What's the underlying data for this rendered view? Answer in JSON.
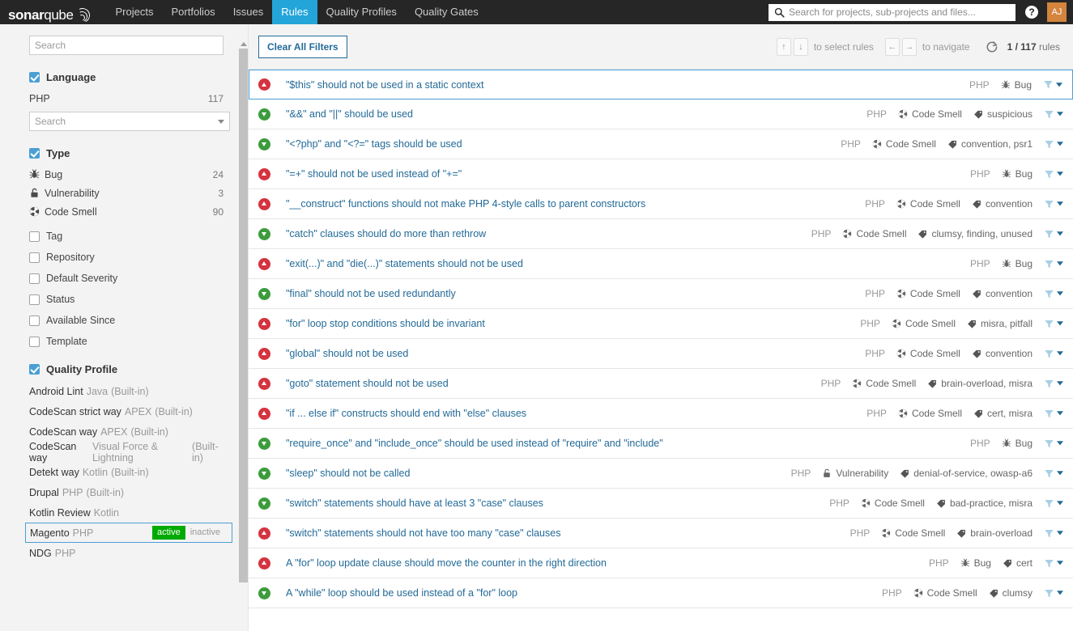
{
  "topnav": {
    "logo_main": "sonar",
    "logo_lite": "qube",
    "items": [
      {
        "label": "Projects",
        "active": false
      },
      {
        "label": "Portfolios",
        "active": false
      },
      {
        "label": "Issues",
        "active": false
      },
      {
        "label": "Rules",
        "active": true
      },
      {
        "label": "Quality Profiles",
        "active": false
      },
      {
        "label": "Quality Gates",
        "active": false
      }
    ],
    "search_placeholder": "Search for projects, sub-projects and files...",
    "help_label": "?",
    "avatar_initials": "AJ"
  },
  "sidebar": {
    "search_placeholder": "Search",
    "language_facet": {
      "title": "Language",
      "checked": true,
      "items": [
        {
          "label": "PHP",
          "count": "117"
        }
      ],
      "select_placeholder": "Search"
    },
    "type_facet": {
      "title": "Type",
      "checked": true,
      "items": [
        {
          "label": "Bug",
          "count": "24",
          "icon": "bug-icon"
        },
        {
          "label": "Vulnerability",
          "count": "3",
          "icon": "vulnerability-icon"
        },
        {
          "label": "Code Smell",
          "count": "90",
          "icon": "code-smell-icon"
        }
      ]
    },
    "collapsed_facets": [
      {
        "label": "Tag"
      },
      {
        "label": "Repository"
      },
      {
        "label": "Default Severity"
      },
      {
        "label": "Status"
      },
      {
        "label": "Available Since"
      },
      {
        "label": "Template"
      }
    ],
    "quality_profile_facet": {
      "title": "Quality Profile",
      "checked": true,
      "active_label": "active",
      "inactive_label": "inactive",
      "items": [
        {
          "name": "Android Lint",
          "lang": "Java",
          "builtin": "(Built-in)",
          "selected": false
        },
        {
          "name": "CodeScan strict way",
          "lang": "APEX",
          "builtin": "(Built-in)",
          "selected": false
        },
        {
          "name": "CodeScan way",
          "lang": "APEX",
          "builtin": "(Built-in)",
          "selected": false
        },
        {
          "name": "CodeScan way",
          "lang": "Visual Force & Lightning",
          "builtin": "(Built-in)",
          "selected": false
        },
        {
          "name": "Detekt way",
          "lang": "Kotlin",
          "builtin": "(Built-in)",
          "selected": false
        },
        {
          "name": "Drupal",
          "lang": "PHP",
          "builtin": "(Built-in)",
          "selected": false
        },
        {
          "name": "Kotlin Review",
          "lang": "Kotlin",
          "builtin": "",
          "selected": false
        },
        {
          "name": "Magento",
          "lang": "PHP",
          "builtin": "",
          "selected": true
        },
        {
          "name": "NDG",
          "lang": "PHP",
          "builtin": "",
          "selected": false
        }
      ]
    }
  },
  "toolbar": {
    "clear_filters_label": "Clear All Filters",
    "key_up": "↑",
    "key_down": "↓",
    "select_hint": "to select rules",
    "key_left": "←",
    "key_right": "→",
    "navigate_hint": "to navigate",
    "rule_position": "1 / 117",
    "rules_word": "rules"
  },
  "rules": [
    {
      "severity": "red",
      "name": "\"$this\" should not be used in a static context",
      "lang": "PHP",
      "type": "Bug",
      "type_icon": "bug-icon",
      "tags": "",
      "selected": true
    },
    {
      "severity": "green",
      "name": "\"&&\" and \"||\" should be used",
      "lang": "PHP",
      "type": "Code Smell",
      "type_icon": "code-smell-icon",
      "tags": "suspicious",
      "selected": false
    },
    {
      "severity": "green",
      "name": "\"<?php\" and \"<?=\" tags should be used",
      "lang": "PHP",
      "type": "Code Smell",
      "type_icon": "code-smell-icon",
      "tags": "convention, psr1",
      "selected": false
    },
    {
      "severity": "red",
      "name": "\"=+\" should not be used instead of \"+=\"",
      "lang": "PHP",
      "type": "Bug",
      "type_icon": "bug-icon",
      "tags": "",
      "selected": false
    },
    {
      "severity": "red",
      "name": "\"__construct\" functions should not make PHP 4-style calls to parent constructors",
      "lang": "PHP",
      "type": "Code Smell",
      "type_icon": "code-smell-icon",
      "tags": "convention",
      "selected": false
    },
    {
      "severity": "green",
      "name": "\"catch\" clauses should do more than rethrow",
      "lang": "PHP",
      "type": "Code Smell",
      "type_icon": "code-smell-icon",
      "tags": "clumsy, finding, unused",
      "selected": false
    },
    {
      "severity": "red",
      "name": "\"exit(...)\" and \"die(...)\" statements should not be used",
      "lang": "PHP",
      "type": "Bug",
      "type_icon": "bug-icon",
      "tags": "",
      "selected": false
    },
    {
      "severity": "green",
      "name": "\"final\" should not be used redundantly",
      "lang": "PHP",
      "type": "Code Smell",
      "type_icon": "code-smell-icon",
      "tags": "convention",
      "selected": false
    },
    {
      "severity": "red",
      "name": "\"for\" loop stop conditions should be invariant",
      "lang": "PHP",
      "type": "Code Smell",
      "type_icon": "code-smell-icon",
      "tags": "misra, pitfall",
      "selected": false
    },
    {
      "severity": "red",
      "name": "\"global\" should not be used",
      "lang": "PHP",
      "type": "Code Smell",
      "type_icon": "code-smell-icon",
      "tags": "convention",
      "selected": false
    },
    {
      "severity": "red",
      "name": "\"goto\" statement should not be used",
      "lang": "PHP",
      "type": "Code Smell",
      "type_icon": "code-smell-icon",
      "tags": "brain-overload, misra",
      "selected": false
    },
    {
      "severity": "red",
      "name": "\"if ... else if\" constructs should end with \"else\" clauses",
      "lang": "PHP",
      "type": "Code Smell",
      "type_icon": "code-smell-icon",
      "tags": "cert, misra",
      "selected": false
    },
    {
      "severity": "green",
      "name": "\"require_once\" and \"include_once\" should be used instead of \"require\" and \"include\"",
      "lang": "PHP",
      "type": "Bug",
      "type_icon": "bug-icon",
      "tags": "",
      "selected": false
    },
    {
      "severity": "green",
      "name": "\"sleep\" should not be called",
      "lang": "PHP",
      "type": "Vulnerability",
      "type_icon": "vulnerability-icon",
      "tags": "denial-of-service, owasp-a6",
      "selected": false
    },
    {
      "severity": "green",
      "name": "\"switch\" statements should have at least 3 \"case\" clauses",
      "lang": "PHP",
      "type": "Code Smell",
      "type_icon": "code-smell-icon",
      "tags": "bad-practice, misra",
      "selected": false
    },
    {
      "severity": "red",
      "name": "\"switch\" statements should not have too many \"case\" clauses",
      "lang": "PHP",
      "type": "Code Smell",
      "type_icon": "code-smell-icon",
      "tags": "brain-overload",
      "selected": false
    },
    {
      "severity": "red",
      "name": "A \"for\" loop update clause should move the counter in the right direction",
      "lang": "PHP",
      "type": "Bug",
      "type_icon": "bug-icon",
      "tags": "cert",
      "selected": false
    },
    {
      "severity": "green",
      "name": "A \"while\" loop should be used instead of a \"for\" loop",
      "lang": "PHP",
      "type": "Code Smell",
      "type_icon": "code-smell-icon",
      "tags": "clumsy",
      "selected": false
    }
  ],
  "colors": {
    "accent": "#4b9fd5",
    "nav_active": "#24a5d9",
    "nav_bg": "#262626",
    "link": "#236a97",
    "severity_red": "#d4333f",
    "severity_green": "#3c9c3c",
    "active_badge": "#00aa00",
    "avatar_bg": "#d4843c"
  }
}
